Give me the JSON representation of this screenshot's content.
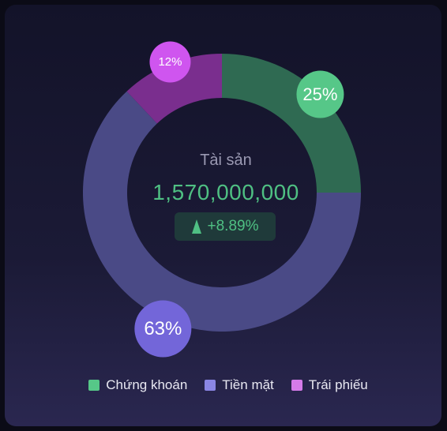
{
  "chart_data": {
    "type": "pie",
    "variant": "donut",
    "categories": [
      "Chứng khoán",
      "Tiền mặt",
      "Trái phiếu"
    ],
    "values": [
      25,
      63,
      12
    ],
    "labels": [
      "25%",
      "63%",
      "12%"
    ],
    "colors": {
      "Chứng khoán": "#2f6a52",
      "Tiền mặt": "#4a4a86",
      "Trái phiếu": "#7a2e8e"
    },
    "label_colors": {
      "Chứng khoán": "#56c788",
      "Tiền mặt": "#7366d9",
      "Trái phiếu": "#cf55ef"
    },
    "legend_colors": [
      "#56c788",
      "#8a86e4",
      "#d57be9"
    ],
    "legend": "bottom-center"
  },
  "center": {
    "title": "Tài sản",
    "value": "1,570,000,000",
    "change": "+8.89%"
  },
  "colors": {
    "accent_green": "#4fc083",
    "text_muted": "#9a99b2"
  }
}
